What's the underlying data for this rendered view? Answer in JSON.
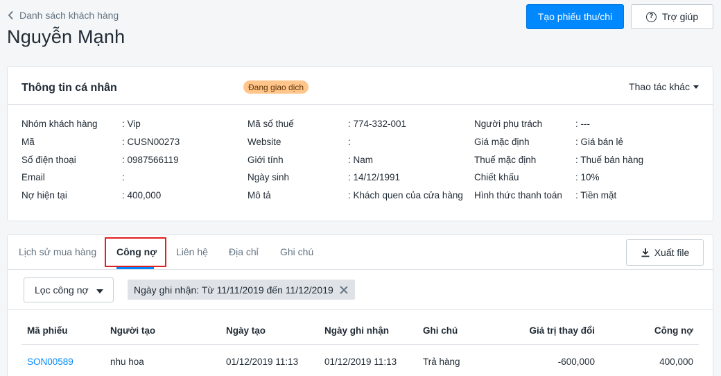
{
  "header": {
    "back_label": "Danh sách khách hàng",
    "title": "Nguyễn Mạnh",
    "primary_button": "Tạo phiếu thu/chi",
    "help_button": "Trợ giúp"
  },
  "info_card": {
    "title": "Thông tin cá nhân",
    "status_badge": "Đang giao dịch",
    "more_actions": "Thao tác khác",
    "col1": [
      {
        "label": "Nhóm khách hàng",
        "value": ": Vip"
      },
      {
        "label": "Mã",
        "value": ": CUSN00273"
      },
      {
        "label": "Số điện thoại",
        "value": ": 0987566119"
      },
      {
        "label": "Email",
        "value": ":"
      },
      {
        "label": "Nợ hiện tại",
        "value": ": 400,000"
      }
    ],
    "col2": [
      {
        "label": "Mã số thuế",
        "value": ": 774-332-001"
      },
      {
        "label": "Website",
        "value": ":"
      },
      {
        "label": "Giới tính",
        "value": ": Nam"
      },
      {
        "label": "Ngày sinh",
        "value": ": 14/12/1991"
      },
      {
        "label": "Mô tả",
        "value": ": Khách quen của cửa hàng"
      }
    ],
    "col3": [
      {
        "label": "Người phụ trách",
        "value": ": ---"
      },
      {
        "label": "Giá mặc định",
        "value": ": Giá bán lẻ"
      },
      {
        "label": "Thuế mặc định",
        "value": ": Thuế bán hàng"
      },
      {
        "label": "Chiết khấu",
        "value": ": 10%"
      },
      {
        "label": "Hình thức thanh toán",
        "value": ": Tiền mặt"
      }
    ]
  },
  "tabs": {
    "items": [
      "Lịch sử mua hàng",
      "Công nợ",
      "Liên hệ",
      "Địa chỉ",
      "Ghi chú"
    ],
    "active_index": 1,
    "export_button": "Xuất file"
  },
  "filter": {
    "select_label": "Lọc công nợ",
    "chip_label": "Ngày ghi nhận: Từ 11/11/2019 đến 11/12/2019"
  },
  "table": {
    "columns": [
      "Mã phiếu",
      "Người tạo",
      "Ngày tạo",
      "Ngày ghi nhận",
      "Ghi chú",
      "Giá trị thay đổi",
      "Công nợ"
    ],
    "rows": [
      [
        "SON00589",
        "nhu hoa",
        "01/12/2019 11:13",
        "01/12/2019 11:13",
        "Trả hàng",
        "-600,000",
        "400,000"
      ]
    ]
  },
  "colors": {
    "primary": "#0088ff",
    "badge_bg": "#ffc58b",
    "highlight": "#e02020"
  }
}
